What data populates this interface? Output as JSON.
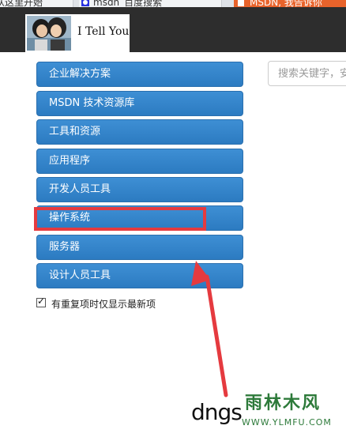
{
  "browser": {
    "tabs": [
      {
        "label": "从这里开始",
        "active": false
      },
      {
        "label": "msdn_百度搜索",
        "active": false
      },
      {
        "label": "MSDN, 我告诉你",
        "active": true
      }
    ]
  },
  "site": {
    "logo_text": "I Tell You"
  },
  "search": {
    "placeholder": "搜索关键字，安"
  },
  "menu": {
    "items": [
      {
        "label": "企业解决方案"
      },
      {
        "label": "MSDN 技术资源库"
      },
      {
        "label": "工具和资源"
      },
      {
        "label": "应用程序"
      },
      {
        "label": "开发人员工具"
      },
      {
        "label": "操作系统"
      },
      {
        "label": "服务器"
      },
      {
        "label": "设计人员工具"
      }
    ],
    "highlighted_index": 5
  },
  "options": {
    "latest_only_label": "有重复项时仅显示最新项",
    "latest_only_checked": true
  },
  "annotation": {
    "text": "dngs"
  },
  "watermark": {
    "title": "雨林木风",
    "url": "WWW.YLMFU.COM"
  },
  "colors": {
    "header_bg": "#2d2d2d",
    "menu_blue": "#3480c8",
    "highlight_red": "#e53a3f",
    "active_tab": "#e8632b"
  }
}
